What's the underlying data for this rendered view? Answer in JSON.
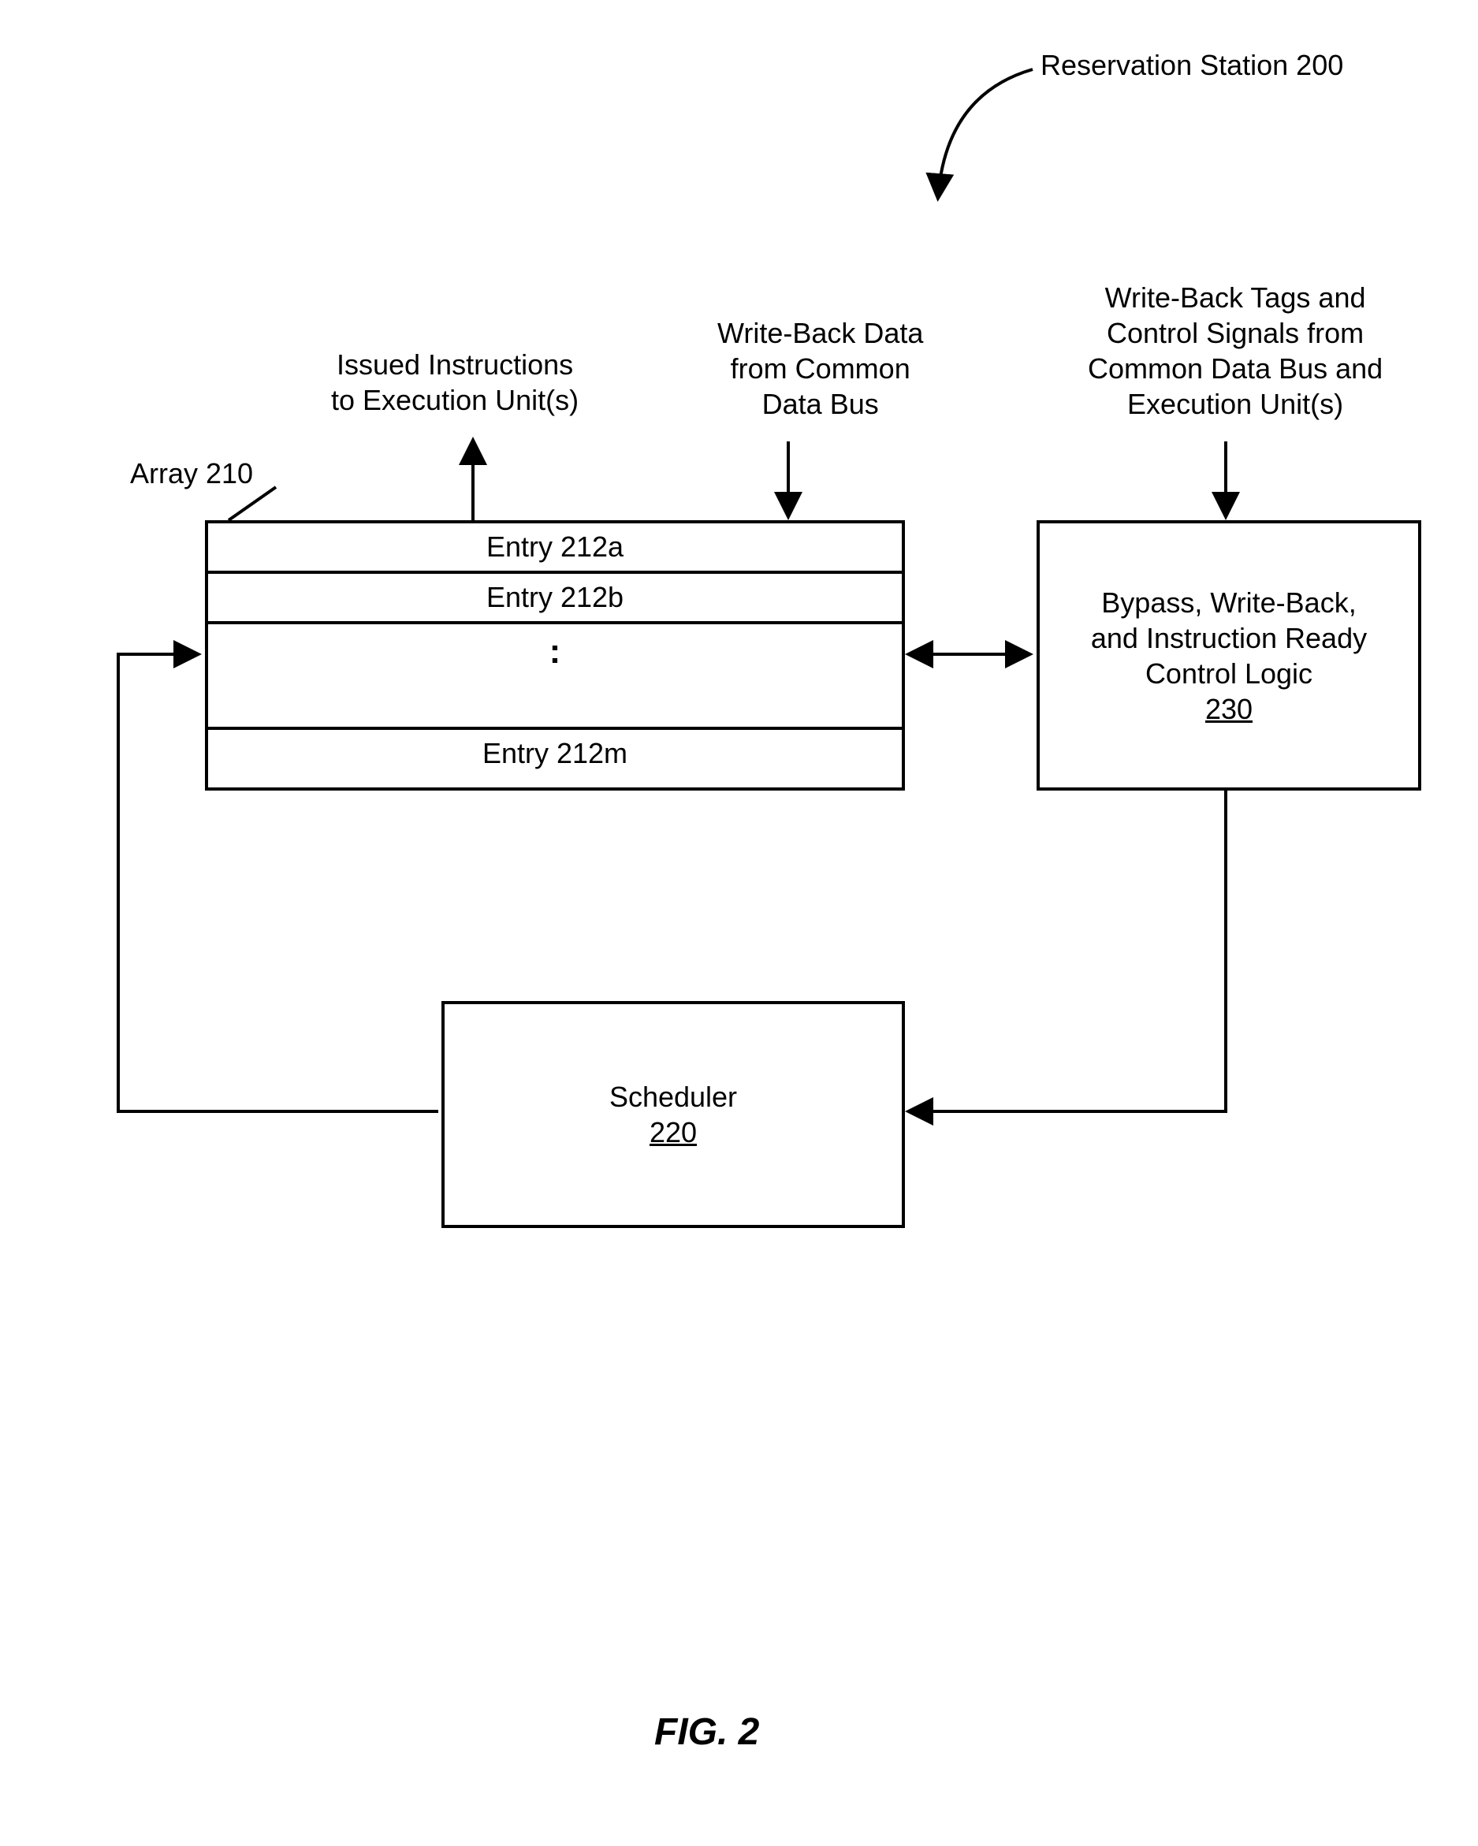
{
  "title": "Reservation Station 200",
  "labels": {
    "issued": "Issued Instructions\nto Execution Unit(s)",
    "wb_data": "Write-Back Data\nfrom Common\nData Bus",
    "wb_tags": "Write-Back Tags and\nControl Signals from\nCommon Data Bus and\nExecution Unit(s)",
    "array": "Array 210"
  },
  "array": {
    "entries": [
      "Entry 212a",
      "Entry 212b",
      "Entry 212m"
    ]
  },
  "control_logic": {
    "line1": "Bypass, Write-Back,",
    "line2": "and Instruction Ready",
    "line3": "Control Logic",
    "ref": "230"
  },
  "scheduler": {
    "name": "Scheduler",
    "ref": "220"
  },
  "figure": "FIG. 2"
}
